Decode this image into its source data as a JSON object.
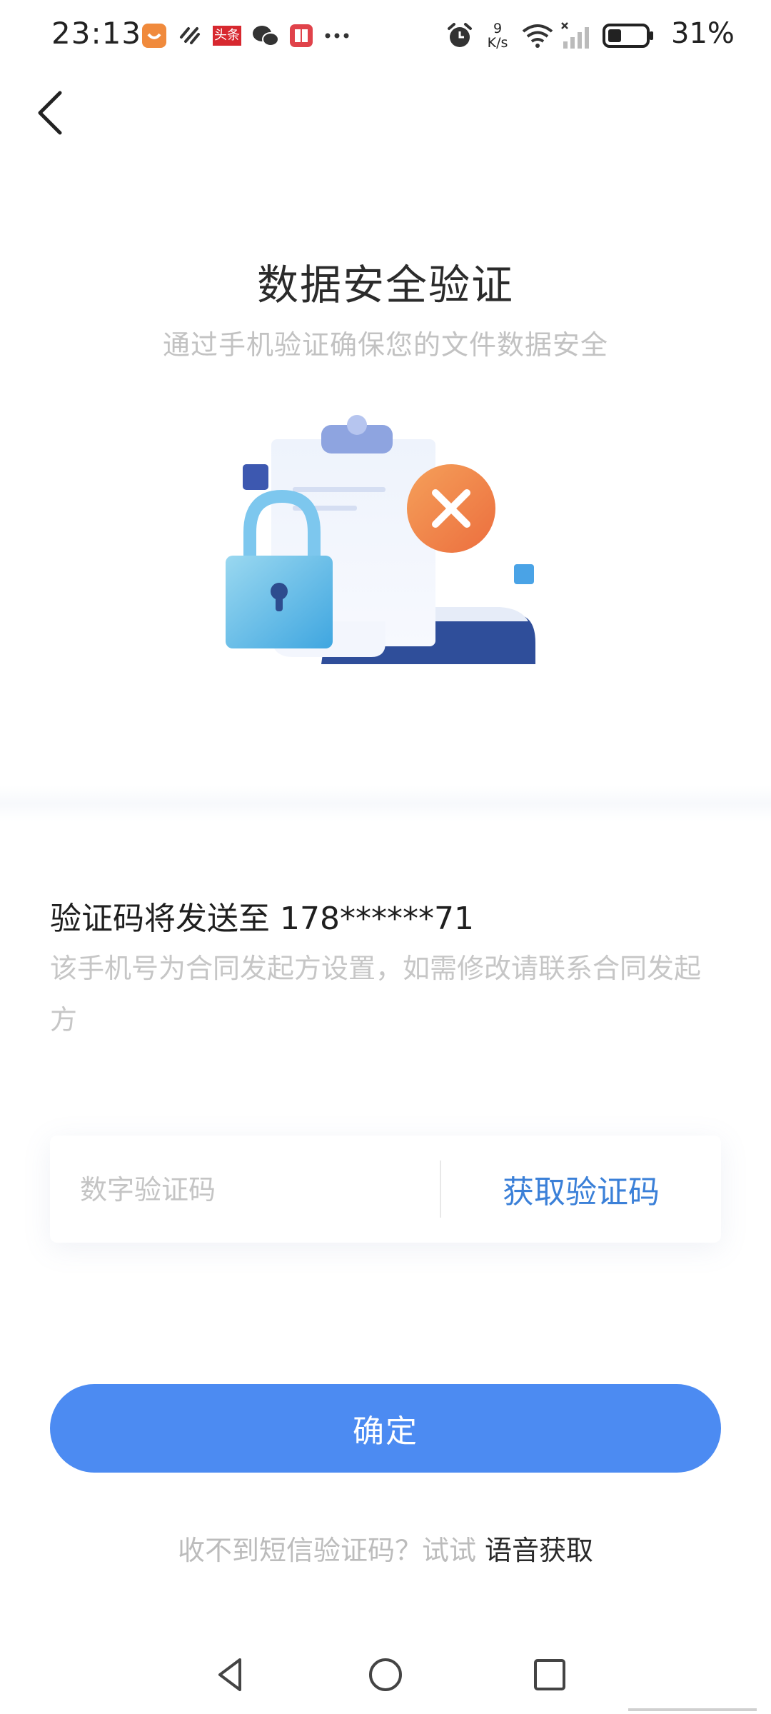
{
  "status_bar": {
    "time": "23:13",
    "net_speed_value": "9",
    "net_speed_unit": "K/s",
    "battery_percent": "31%",
    "toutiao_label": "头条"
  },
  "header": {
    "title": "数据安全验证",
    "subtitle": "通过手机验证确保您的文件数据安全"
  },
  "verification": {
    "send_to_prefix": "验证码将发送至 ",
    "phone_masked": "178******71",
    "note": "该手机号为合同发起方设置，如需修改请联系合同发起方"
  },
  "code_input": {
    "placeholder": "数字验证码",
    "value": ""
  },
  "get_code_label": "获取验证码",
  "confirm_label": "确定",
  "voice": {
    "prompt": "收不到短信验证码？试试 ",
    "link": "语音获取"
  },
  "colors": {
    "primary": "#4c8bf2",
    "link": "#3b80d8",
    "muted": "#c4c4c4"
  },
  "icons": [
    "back-arrow-icon",
    "lock-icon",
    "clipboard-icon",
    "close-badge-icon",
    "alarm-icon",
    "wifi-icon",
    "signal-icon",
    "battery-icon",
    "nav-back-icon",
    "nav-home-icon",
    "nav-recents-icon"
  ]
}
